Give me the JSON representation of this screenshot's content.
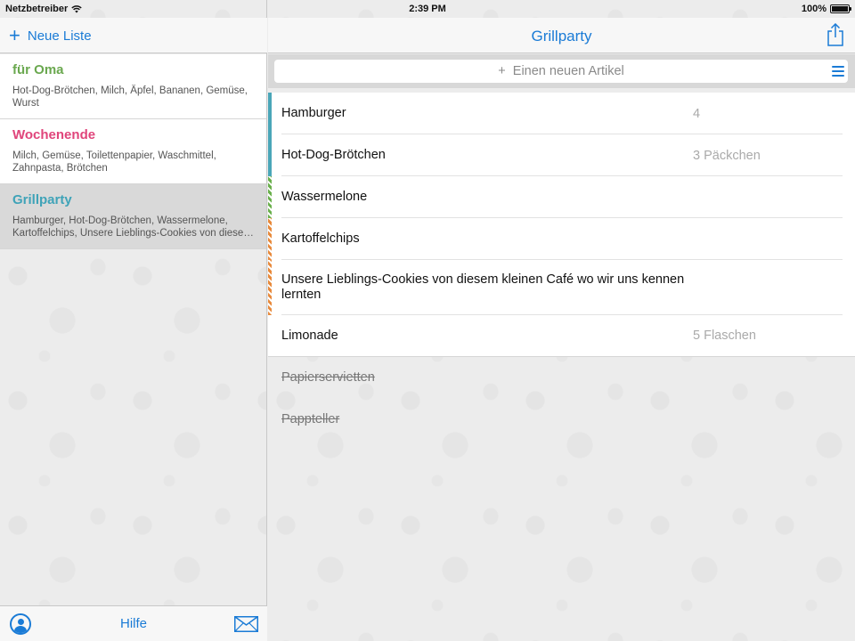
{
  "status": {
    "carrier": "Netzbetreiber",
    "time": "2:39 PM",
    "battery": "100%"
  },
  "sidebar": {
    "new_list_label": "Neue Liste",
    "lists": [
      {
        "title": "für Oma",
        "summary": "Hot-Dog-Brötchen, Milch, Äpfel, Bananen, Gemüse, Wurst",
        "color": "#6aa84f"
      },
      {
        "title": "Wochenende",
        "summary": "Milch, Gemüse, Toilettenpapier, Waschmittel, Zahnpasta, Brötchen",
        "color": "#e0457b"
      },
      {
        "title": "Grillparty",
        "summary": "Hamburger, Hot-Dog-Brötchen, Wassermelone, Kartoffelchips, Unsere Lieblings-Cookies von diesem kleinen Café wo wir uns kennen lernten, Limonade",
        "color": "#3fa3b8"
      }
    ],
    "help_label": "Hilfe"
  },
  "main": {
    "title": "Grillparty",
    "add_placeholder": "+  Einen neuen Artikel",
    "items": [
      {
        "name": "Hamburger",
        "qty": "4",
        "marker": "solid"
      },
      {
        "name": "Hot-Dog-Brötchen",
        "qty": "3 Päckchen",
        "marker": "solid"
      },
      {
        "name": "Wassermelone",
        "qty": "",
        "marker": "green"
      },
      {
        "name": "Kartoffelchips",
        "qty": "",
        "marker": "orange"
      },
      {
        "name": "Unsere Lieblings-Cookies von diesem kleinen Café wo wir uns kennen lernten",
        "qty": "",
        "marker": "orange"
      },
      {
        "name": "Limonade",
        "qty": "5 Flaschen",
        "marker": ""
      }
    ],
    "done_items": [
      "Papierservietten",
      "Pappteller"
    ]
  },
  "colors": {
    "accent": "#1a7bd6"
  }
}
